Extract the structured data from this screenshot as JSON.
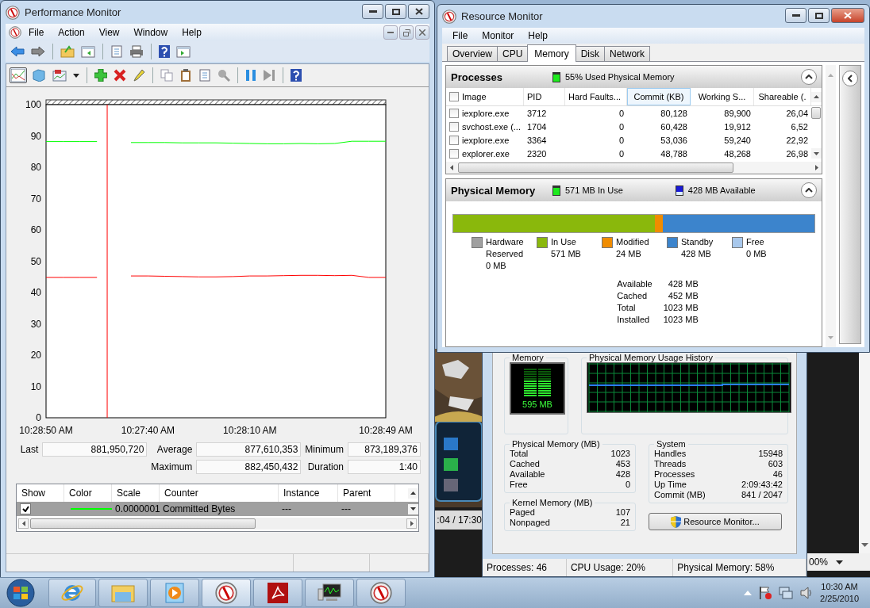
{
  "perfmon": {
    "title": "Performance Monitor",
    "menu": [
      "File",
      "Action",
      "View",
      "Window",
      "Help"
    ],
    "chart_data": {
      "type": "line",
      "categories": [
        "10:28:50 AM",
        null,
        null,
        null,
        null,
        null,
        "10:27:40 AM",
        null,
        null,
        null,
        null,
        null,
        "10:28:10 AM",
        null,
        null,
        null,
        null,
        null,
        null,
        null,
        "10:28:49 AM"
      ],
      "ylim": [
        0,
        100
      ],
      "yticks": [
        0,
        10,
        20,
        30,
        40,
        50,
        60,
        70,
        80,
        90,
        100
      ],
      "series": [
        {
          "color": "#00ff00",
          "values": [
            88.2,
            88.2,
            88.2,
            88.2,
            null,
            87.9,
            87.9,
            87.9,
            87.8,
            87.8,
            87.8,
            87.7,
            87.6,
            87.5,
            87.5,
            87.6,
            87.5,
            87.6,
            88.3,
            88.3,
            88.3
          ]
        },
        {
          "color": "#ff0000",
          "values": [
            44.8,
            44.8,
            44.8,
            44.8,
            null,
            45.3,
            45.3,
            45.2,
            45.1,
            45.0,
            45.0,
            45.1,
            45.3,
            45.3,
            45.4,
            45.5,
            45.5,
            45.4,
            45.5,
            44.8,
            44.8
          ]
        }
      ]
    },
    "stats": [
      {
        "label": "Last",
        "value": "881,950,720"
      },
      {
        "label": "Average",
        "value": "877,610,353"
      },
      {
        "label": "Minimum",
        "value": "873,189,376"
      },
      {
        "label": "Maximum",
        "value": "882,450,432"
      },
      {
        "label": "Duration",
        "value": "1:40"
      }
    ],
    "counters": {
      "columns": [
        "Show",
        "Color",
        "Scale",
        "Counter",
        "Instance",
        "Parent"
      ],
      "rows": [
        {
          "show": true,
          "color": "#00ff00",
          "scale": "0.0000001",
          "counter": "Committed Bytes",
          "instance": "---",
          "parent": "---",
          "selected": true
        }
      ]
    }
  },
  "video_player": {
    "time": ":04 / 17:30"
  },
  "background_window": {
    "zoom": "00%"
  },
  "task_manager": {
    "memory_gauge": {
      "title": "Memory",
      "reading": "595 MB",
      "level": 0.58
    },
    "history": {
      "title": "Physical Memory Usage History"
    },
    "physical_memory": {
      "title": "Physical Memory (MB)",
      "rows": [
        {
          "label": "Total",
          "value": "1023"
        },
        {
          "label": "Cached",
          "value": "453"
        },
        {
          "label": "Available",
          "value": "428"
        },
        {
          "label": "Free",
          "value": "0"
        }
      ]
    },
    "kernel_memory": {
      "title": "Kernel Memory (MB)",
      "rows": [
        {
          "label": "Paged",
          "value": "107"
        },
        {
          "label": "Nonpaged",
          "value": "21"
        }
      ]
    },
    "system": {
      "title": "System",
      "rows": [
        {
          "label": "Handles",
          "value": "15948"
        },
        {
          "label": "Threads",
          "value": "603"
        },
        {
          "label": "Processes",
          "value": "46"
        },
        {
          "label": "Up Time",
          "value": "2:09:43:42"
        },
        {
          "label": "Commit (MB)",
          "value": "841 / 2047"
        }
      ]
    },
    "button": "Resource Monitor...",
    "status_bar": [
      "Processes: 46",
      "CPU Usage: 20%",
      "Physical Memory: 58%"
    ]
  },
  "resmon": {
    "title": "Resource Monitor",
    "menu": [
      "File",
      "Monitor",
      "Help"
    ],
    "tabs": [
      {
        "label": "Overview",
        "selected": false
      },
      {
        "label": "CPU",
        "selected": false
      },
      {
        "label": "Memory",
        "selected": true
      },
      {
        "label": "Disk",
        "selected": false
      },
      {
        "label": "Network",
        "selected": false
      }
    ],
    "processes": {
      "title": "Processes",
      "summary": "55% Used Physical Memory",
      "columns": [
        {
          "label": "Image",
          "sorted": false
        },
        {
          "label": "PID",
          "sorted": false
        },
        {
          "label": "Hard Faults...",
          "sorted": false
        },
        {
          "label": "Commit (KB)",
          "sorted": true
        },
        {
          "label": "Working S...",
          "sorted": false
        },
        {
          "label": "Shareable (.",
          "sorted": false
        }
      ],
      "rows": [
        {
          "checked": false,
          "cells": [
            "iexplore.exe",
            "3712",
            "0",
            "80,128",
            "89,900",
            "26,04"
          ]
        },
        {
          "checked": false,
          "cells": [
            "svchost.exe (...",
            "1704",
            "0",
            "60,428",
            "19,912",
            "6,52"
          ]
        },
        {
          "checked": false,
          "cells": [
            "iexplore.exe",
            "3364",
            "0",
            "53,036",
            "59,240",
            "22,92"
          ]
        },
        {
          "checked": false,
          "cells": [
            "explorer.exe",
            "2320",
            "0",
            "48,788",
            "48,268",
            "26,98"
          ]
        }
      ]
    },
    "physical_memory": {
      "title": "Physical Memory",
      "in_use": "571 MB In Use",
      "available": "428 MB Available",
      "legend": [
        {
          "name": "Hardware Reserved",
          "value": "0 MB",
          "color": "#a0a0a0"
        },
        {
          "name": "In Use",
          "value": "571 MB",
          "color": "#8ab80c",
          "level": 0.558
        },
        {
          "name": "Modified",
          "value": "24 MB",
          "color": "#f08c00",
          "level": 0.023
        },
        {
          "name": "Standby",
          "value": "428 MB",
          "color": "#3c84cc",
          "level": 0.419
        },
        {
          "name": "Free",
          "value": "0 MB",
          "color": "#a8c8ec"
        }
      ],
      "summary": [
        {
          "label": "Available",
          "value": "428 MB"
        },
        {
          "label": "Cached",
          "value": "452 MB"
        },
        {
          "label": "Total",
          "value": "1023 MB"
        },
        {
          "label": "Installed",
          "value": "1023 MB"
        }
      ]
    }
  },
  "taskbar": {
    "clock": {
      "time": "10:30 AM",
      "date": "2/25/2010"
    }
  }
}
